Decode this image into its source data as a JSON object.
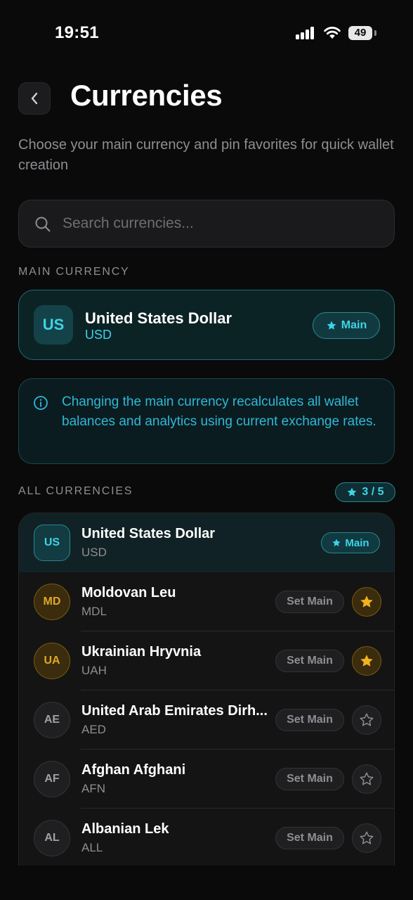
{
  "status_bar": {
    "time": "19:51",
    "battery": "49"
  },
  "header": {
    "title": "Currencies",
    "subtitle": "Choose your main currency and pin favorites for quick wallet creation"
  },
  "search": {
    "placeholder": "Search currencies...",
    "value": ""
  },
  "main_section": {
    "label": "MAIN CURRENCY",
    "currency": {
      "badge": "US",
      "name": "United States Dollar",
      "code": "USD",
      "pill_label": "Main"
    }
  },
  "info": {
    "text": "Changing the main currency recalculates all wallet balances and analytics using current exchange rates."
  },
  "all_section": {
    "label": "ALL CURRENCIES",
    "favorites_count": "3 / 5"
  },
  "colors": {
    "accent": "#3fd3e6",
    "favorite": "#f2b21d",
    "background": "#0a0a0a"
  },
  "currencies": [
    {
      "badge": "US",
      "name": "United States Dollar",
      "code": "USD",
      "is_main": true,
      "favorite": true,
      "action_label": "Main"
    },
    {
      "badge": "MD",
      "name": "Moldovan Leu",
      "code": "MDL",
      "is_main": false,
      "favorite": true,
      "action_label": "Set Main"
    },
    {
      "badge": "UA",
      "name": "Ukrainian Hryvnia",
      "code": "UAH",
      "is_main": false,
      "favorite": true,
      "action_label": "Set Main"
    },
    {
      "badge": "AE",
      "name": "United Arab Emirates Dirh...",
      "code": "AED",
      "is_main": false,
      "favorite": false,
      "action_label": "Set Main"
    },
    {
      "badge": "AF",
      "name": "Afghan Afghani",
      "code": "AFN",
      "is_main": false,
      "favorite": false,
      "action_label": "Set Main"
    },
    {
      "badge": "AL",
      "name": "Albanian Lek",
      "code": "ALL",
      "is_main": false,
      "favorite": false,
      "action_label": "Set Main"
    }
  ]
}
